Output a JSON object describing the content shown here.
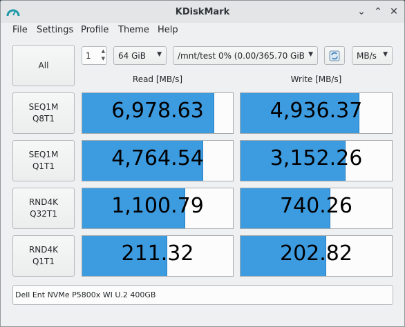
{
  "window": {
    "title": "KDiskMark"
  },
  "menu": [
    "File",
    "Settings",
    "Profile",
    "Theme",
    "Help"
  ],
  "controls": {
    "all_label": "All",
    "loops": "1",
    "size": "64 GiB",
    "target": "/mnt/test 0% (0.00/365.70 GiB",
    "unit": "MB/s"
  },
  "headers": {
    "read": "Read [MB/s]",
    "write": "Write [MB/s]"
  },
  "tests": [
    {
      "label": "SEQ1M\nQ8T1",
      "read": "6,978.63",
      "write": "4,936.37",
      "read_fill": 0.87,
      "write_fill": 0.78
    },
    {
      "label": "SEQ1M\nQ1T1",
      "read": "4,764.54",
      "write": "3,152.26",
      "read_fill": 0.8,
      "write_fill": 0.69
    },
    {
      "label": "RND4K\nQ32T1",
      "read": "1,100.79",
      "write": "740.26",
      "read_fill": 0.68,
      "write_fill": 0.59
    },
    {
      "label": "RND4K\nQ1T1",
      "read": "211.32",
      "write": "202.82",
      "read_fill": 0.56,
      "write_fill": 0.56
    }
  ],
  "device": "Dell Ent NVMe P5800x WI U.2 400GB",
  "colors": {
    "bar": "#3d9be0",
    "window_bg": "#eff0f1",
    "desktop": "#2b3b44"
  }
}
